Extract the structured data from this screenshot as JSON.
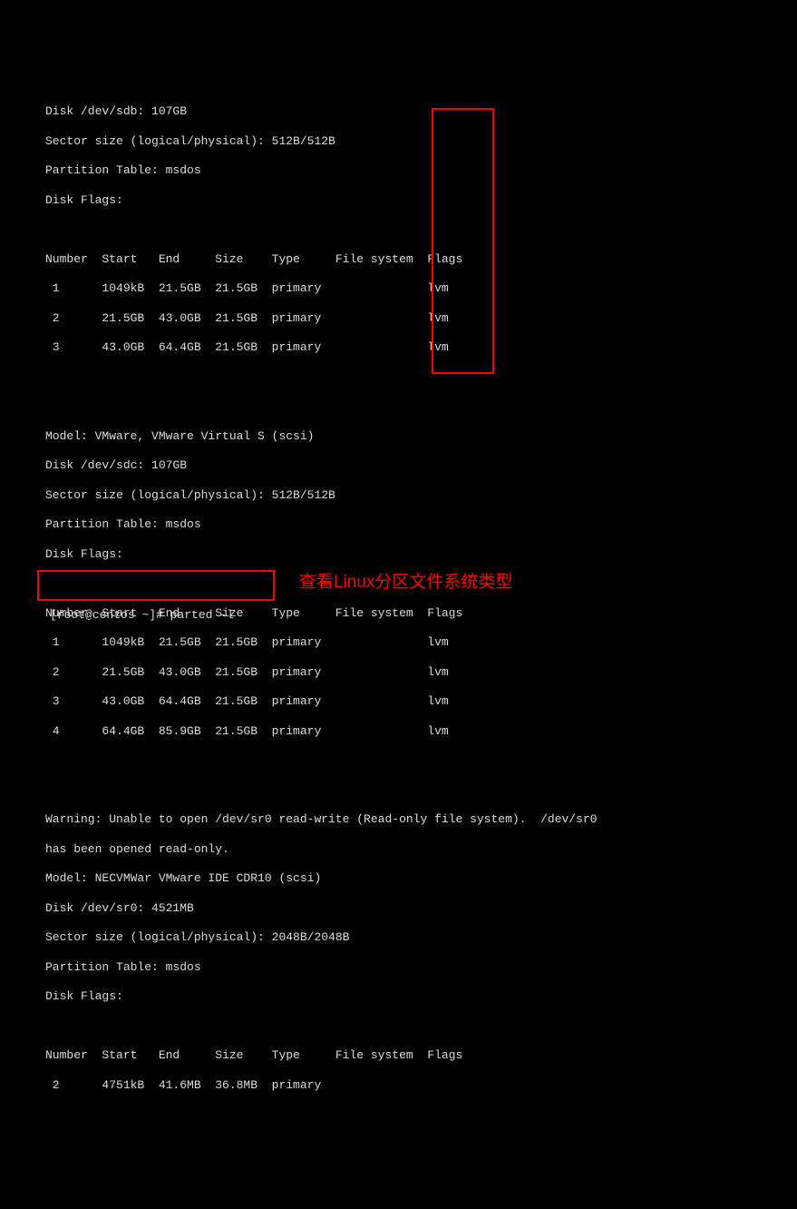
{
  "disk1": {
    "header": "Disk /dev/sdb: 107GB",
    "sector": "Sector size (logical/physical): 512B/512B",
    "ptable": "Partition Table: msdos",
    "flags": "Disk Flags:",
    "cols": "Number  Start   End     Size    Type     File system  Flags",
    "rows": [
      " 1      1049kB  21.5GB  21.5GB  primary               lvm",
      " 2      21.5GB  43.0GB  21.5GB  primary               lvm",
      " 3      43.0GB  64.4GB  21.5GB  primary               lvm"
    ]
  },
  "disk2": {
    "model": "Model: VMware, VMware Virtual S (scsi)",
    "header": "Disk /dev/sdc: 107GB",
    "sector": "Sector size (logical/physical): 512B/512B",
    "ptable": "Partition Table: msdos",
    "flags": "Disk Flags:",
    "cols": "Number  Start   End     Size    Type     File system  Flags",
    "rows": [
      " 1      1049kB  21.5GB  21.5GB  primary               lvm",
      " 2      21.5GB  43.0GB  21.5GB  primary               lvm",
      " 3      43.0GB  64.4GB  21.5GB  primary               lvm",
      " 4      64.4GB  85.9GB  21.5GB  primary               lvm"
    ]
  },
  "disk3": {
    "warn": "Warning: Unable to open /dev/sr0 read-write (Read-only file system).  /dev/sr0",
    "warn2": "has been opened read-only.",
    "model": "Model: NECVMWar VMware IDE CDR10 (scsi)",
    "header": "Disk /dev/sr0: 4521MB",
    "sector": "Sector size (logical/physical): 2048B/2048B",
    "ptable": "Partition Table: msdos",
    "flags": "Disk Flags:",
    "cols": "Number  Start   End     Size    Type     File system  Flags",
    "rows": [
      " 2      4751kB  41.6MB  36.8MB  primary"
    ]
  },
  "prompt": "[root@centos ~]# parted -l",
  "annotation": "查看Linux分区文件系统类型"
}
